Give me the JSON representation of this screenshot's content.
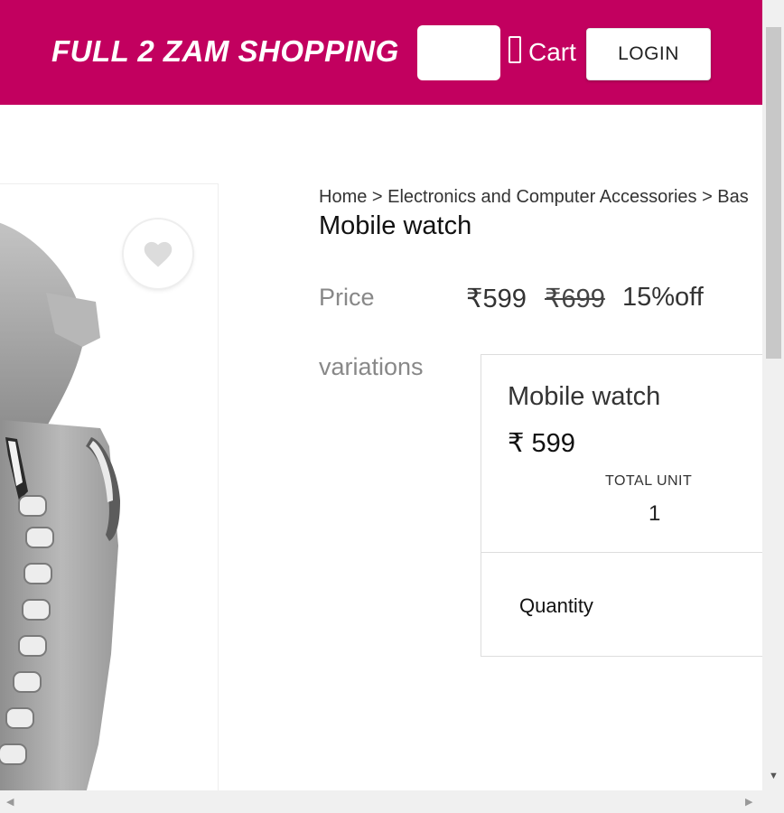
{
  "header": {
    "brand": "FULL 2 ZAM SHOPPING",
    "search_icon_glyph": "",
    "cart_label": "Cart",
    "login_label": "LOGIN",
    "background_color": "#c2005f"
  },
  "product": {
    "breadcrumb": "Home > Electronics and Computer Accessories > Bas",
    "title": "Mobile watch",
    "price_label": "Price",
    "price_current": "₹599",
    "price_original": "₹699",
    "price_discount": "15%off",
    "variations_label": "variations",
    "wishlist_icon": "heart-icon"
  },
  "variation": {
    "name": "Mobile watch",
    "price": "₹ 599",
    "total_unit_label": "TOTAL UNIT",
    "total_unit_value": "1",
    "quantity_label": "Quantity"
  }
}
